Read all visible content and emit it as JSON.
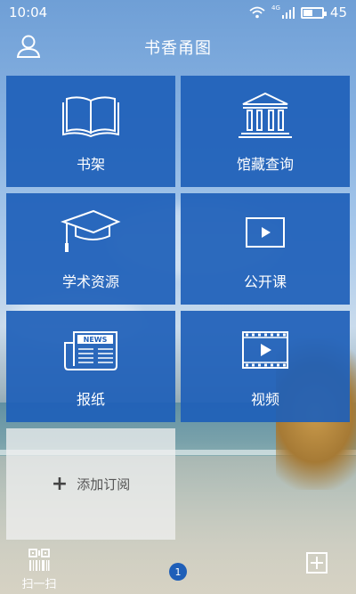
{
  "status_bar": {
    "time": "10:04",
    "battery_level": "45",
    "battery_fill_fraction": 0.45,
    "signal_label": "4G"
  },
  "header": {
    "title": "书香甬图"
  },
  "tiles": [
    {
      "label": "书架",
      "icon": "book-icon"
    },
    {
      "label": "馆藏查询",
      "icon": "library-building-icon"
    },
    {
      "label": "学术资源",
      "icon": "graduation-cap-icon"
    },
    {
      "label": "公开课",
      "icon": "play-screen-icon"
    },
    {
      "label": "报纸",
      "icon": "newspaper-icon",
      "icon_text": "NEWS"
    },
    {
      "label": "视频",
      "icon": "video-film-icon"
    }
  ],
  "add_tile": {
    "label": "添加订阅",
    "icon": "plus-icon"
  },
  "bottom_bar": {
    "scan_label": "扫一扫",
    "page_number": "1"
  },
  "colors": {
    "tile_blue": "#1e5fb9",
    "page_dot": "#1f5fb8"
  }
}
